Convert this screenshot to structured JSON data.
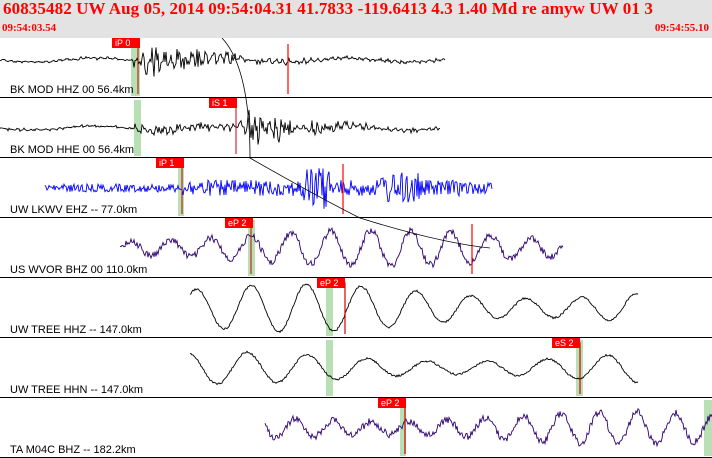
{
  "header": {
    "title": "60835482 UW Aug 05, 2014 09:54:04.31   41.7833 -119.6413  4.3 1.40 Md re amyw UW 01   3",
    "start_time": "09:54:03.54",
    "end_time": "09:54:55.10"
  },
  "colors": {
    "header_bg": "#e3e3e3",
    "header_text": "#ff0000",
    "pick_box": "#ff0000",
    "pick_window": "#b9e0b5",
    "highlight_trace": "#0000ff",
    "purple_trace": "#2c006e"
  },
  "traces": [
    {
      "label": "BK MOD HHZ 00 56.4km",
      "pick": "iP 0",
      "color": "#000000"
    },
    {
      "label": "BK MOD HHE 00 56.4km",
      "pick": "iS 1",
      "color": "#000000"
    },
    {
      "label": "UW LKWV EHZ -- 77.0km",
      "pick": "iP 1",
      "color": "#0000ff"
    },
    {
      "label": "US WVOR BHZ 00 110.0km",
      "pick": "eP 2",
      "color": "#2c006e"
    },
    {
      "label": "UW TREE HHZ -- 147.0km",
      "pick": "eP 2",
      "color": "#000000"
    },
    {
      "label": "UW TREE HHN -- 147.0km",
      "pick": "eS 2",
      "color": "#000000"
    },
    {
      "label": "TA M04C BHZ -- 182.2km",
      "pick": "eP 2",
      "color": "#2c006e"
    }
  ]
}
